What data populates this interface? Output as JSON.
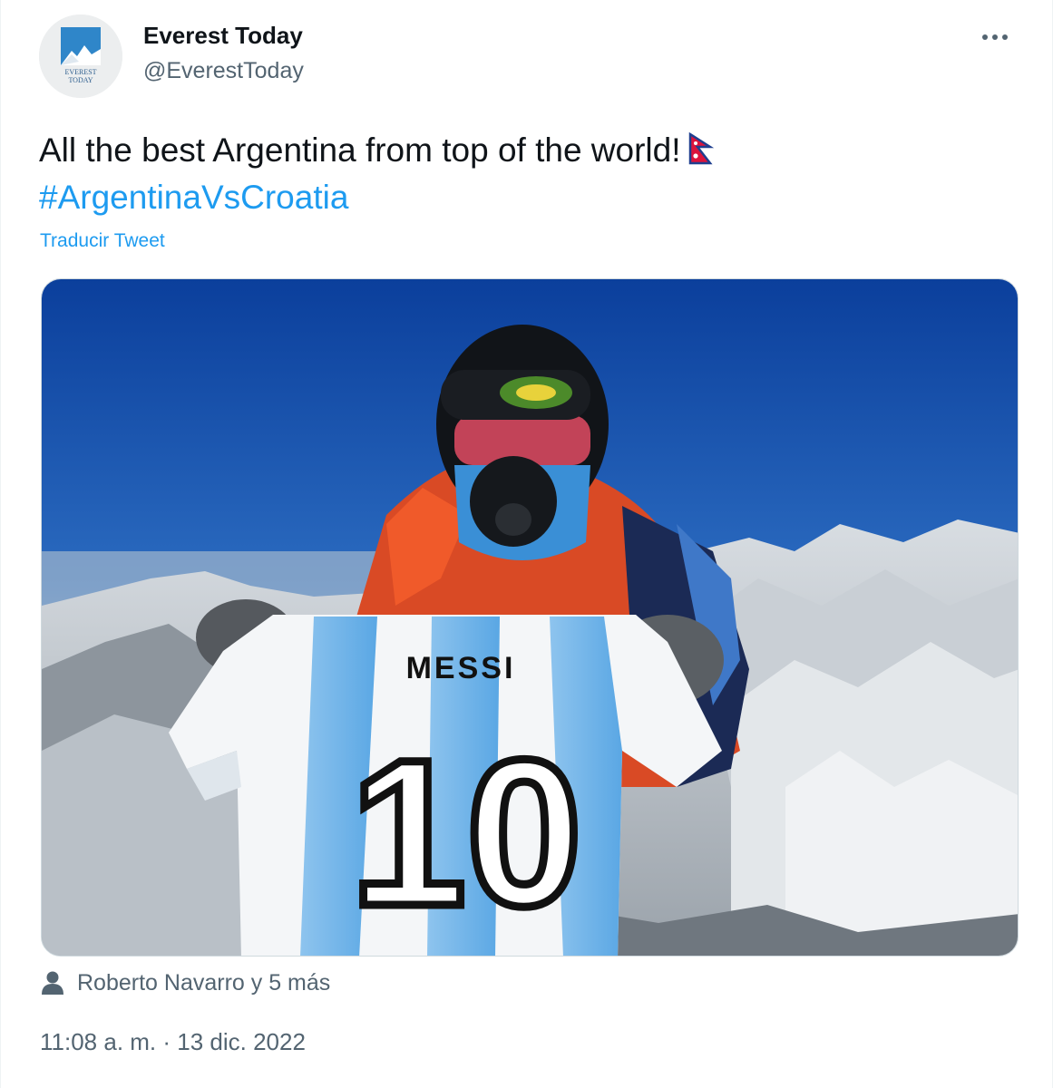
{
  "author": {
    "name": "Everest Today",
    "handle": "@EverestToday",
    "avatar_logo_text": [
      "EVEREST",
      "TODAY"
    ]
  },
  "menu": {
    "more_icon": "more-horizontal-icon"
  },
  "tweet": {
    "text": "All the best Argentina from top of the world!",
    "emoji_icon": "nepal-flag-icon",
    "hashtag": "#ArgentinaVsCroatia",
    "translate_label": "Traducir Tweet"
  },
  "media": {
    "photo_text": {
      "jersey_name": "MESSI",
      "jersey_number": "10"
    }
  },
  "tagged": {
    "icon": "person-icon",
    "label": "Roberto Navarro y 5 más"
  },
  "meta": {
    "timestamp": "11:08 a. m. · 13 dic. 2022"
  },
  "colors": {
    "accent": "#1d9bf0",
    "secondary_text": "#536471",
    "primary_text": "#0f1419"
  }
}
